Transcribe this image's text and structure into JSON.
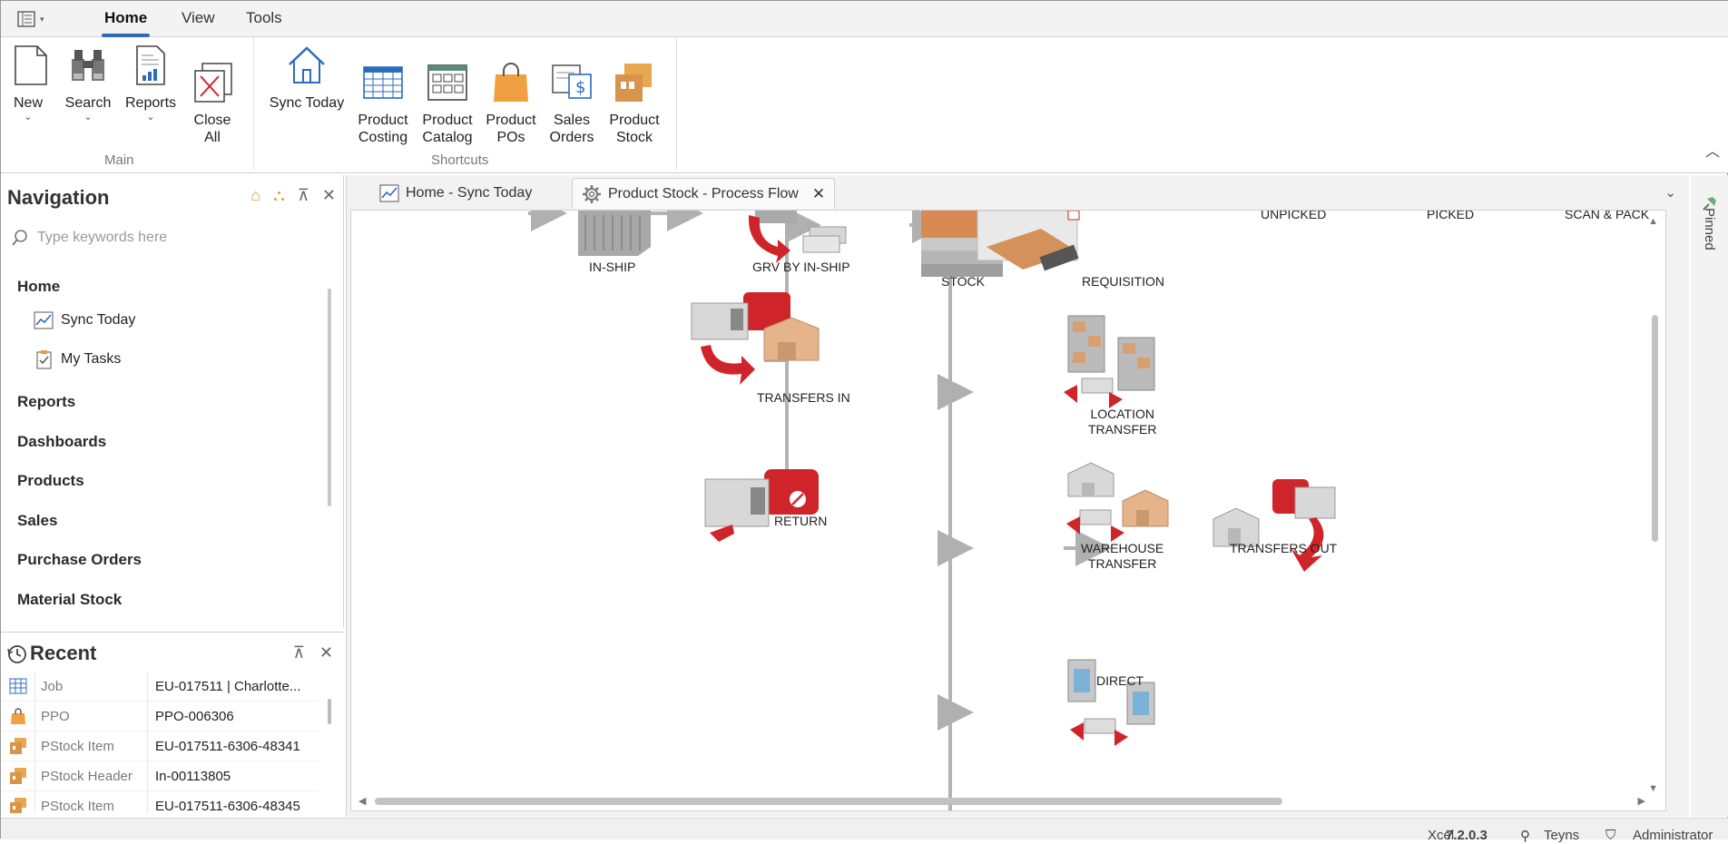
{
  "ribbon": {
    "tabs": [
      "Home",
      "View",
      "Tools"
    ],
    "main_buttons": [
      {
        "label": "New",
        "has_dropdown": true
      },
      {
        "label": "Search",
        "has_dropdown": true
      },
      {
        "label": "Reports",
        "has_dropdown": true
      },
      {
        "label": "Close\nAll",
        "has_dropdown": false
      }
    ],
    "main_group_label": "Main",
    "shortcut_buttons": [
      {
        "label": "Sync Today"
      },
      {
        "label": "Product\nCosting"
      },
      {
        "label": "Product\nCatalog"
      },
      {
        "label": "Product\nPOs"
      },
      {
        "label": "Sales\nOrders"
      },
      {
        "label": "Product\nStock"
      }
    ],
    "shortcuts_group_label": "Shortcuts"
  },
  "navigation": {
    "title": "Navigation",
    "search_placeholder": "Type keywords here",
    "sections": [
      "Home",
      "Reports",
      "Dashboards",
      "Products",
      "Sales",
      "Purchase Orders",
      "Material Stock"
    ],
    "home_items": [
      "Sync Today",
      "My Tasks"
    ]
  },
  "recent": {
    "title": "Recent",
    "rows": [
      {
        "type": "Job",
        "value": "EU-017511 | Charlotte...",
        "icon": "grid-icon"
      },
      {
        "type": "PPO",
        "value": "PPO-006306",
        "icon": "bag-icon"
      },
      {
        "type": "PStock Item",
        "value": "EU-017511-6306-48341",
        "icon": "box-icon"
      },
      {
        "type": "PStock Header",
        "value": "In-00113805",
        "icon": "box-icon"
      },
      {
        "type": "PStock Item",
        "value": "EU-017511-6306-48345",
        "icon": "box-icon"
      }
    ]
  },
  "documents": {
    "tabs": [
      {
        "label": "Home - Sync Today",
        "active": false
      },
      {
        "label": "Product Stock - Process Flow",
        "active": true
      }
    ]
  },
  "flow": {
    "labels": {
      "in_ship": "IN-SHIP",
      "grv": "GRV BY IN-SHIP",
      "stock": "STOCK",
      "requisition": "REQUISITION",
      "unpicked": "UNPICKED",
      "picked": "PICKED",
      "scan_pack": "SCAN & PACK",
      "transfers_in": "TRANSFERS IN",
      "location_transfer": "LOCATION\nTRANSFER",
      "return": "RETURN",
      "warehouse_transfer": "WAREHOUSE\nTRANSFER",
      "transfers_out": "TRANSFERS OUT",
      "direct": "DIRECT"
    }
  },
  "pinned_label": "Pinned",
  "status": {
    "item1": "Xcel",
    "version": "7.2.0.3",
    "user_short": "Teyns",
    "role": "Administrator"
  },
  "colors": {
    "accent": "#2e6bbd",
    "truck_red": "#d0242b",
    "box_tan": "#e2b48a",
    "grey": "#9aa0a6"
  }
}
